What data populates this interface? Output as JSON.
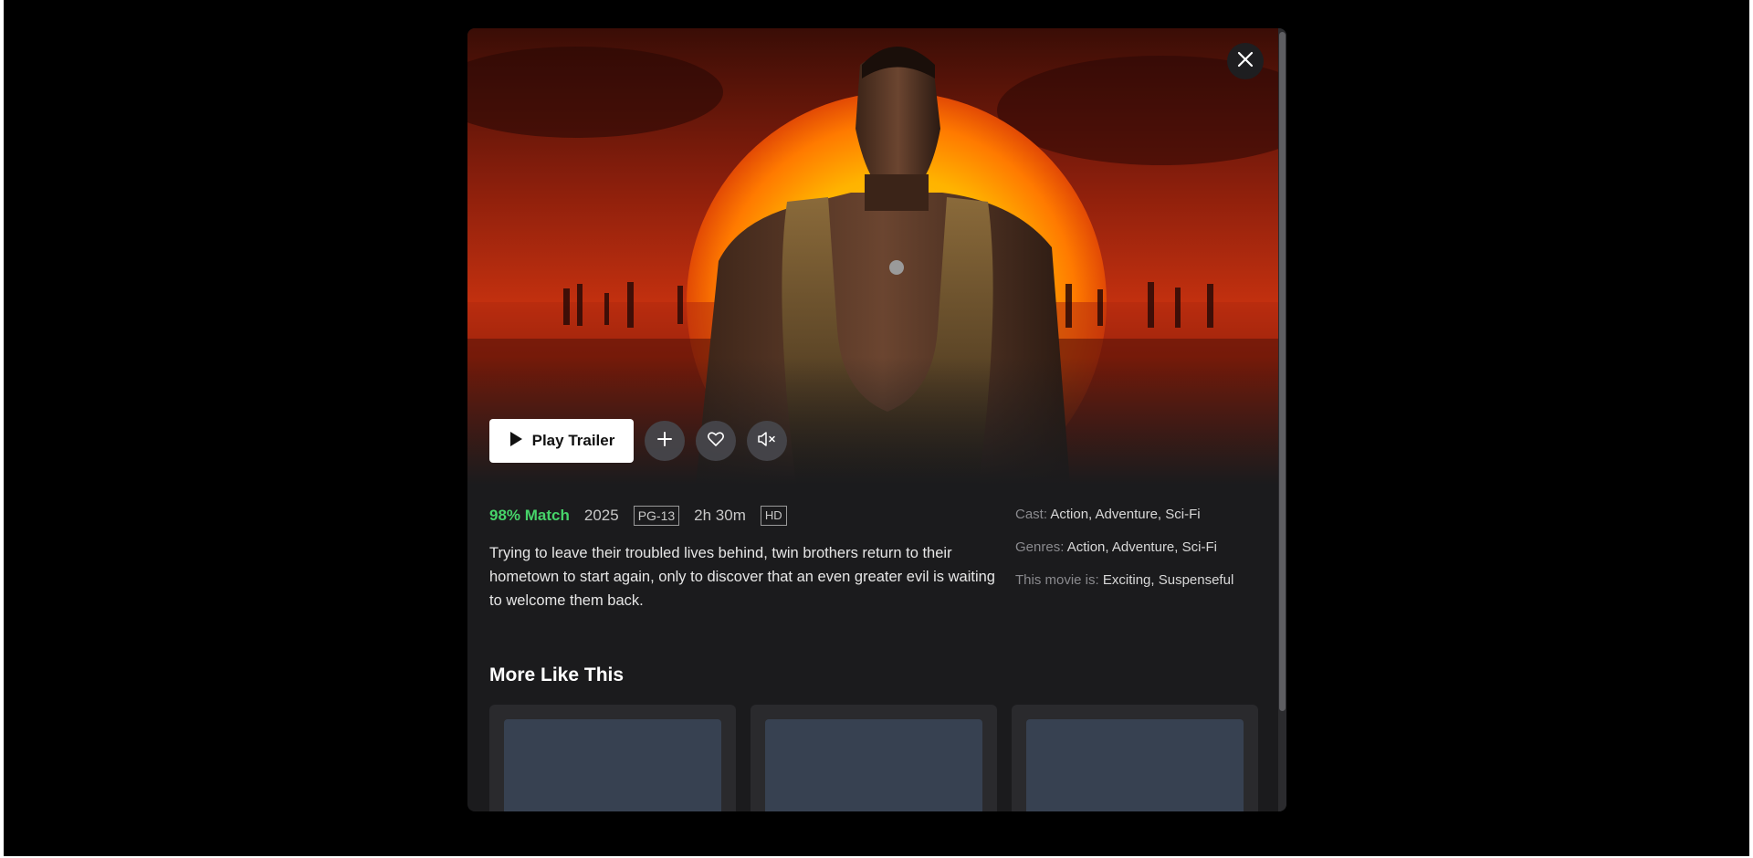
{
  "modal": {
    "close_label": "Close"
  },
  "actions": {
    "play_label": "Play Trailer"
  },
  "meta": {
    "match": "98% Match",
    "year": "2025",
    "rating": "PG-13",
    "runtime": "2h 30m",
    "quality": "HD"
  },
  "synopsis": "Trying to leave their troubled lives behind, twin brothers return to their hometown to start again, only to discover that an even greater evil is waiting to welcome them back.",
  "side_info": {
    "cast_label": "Cast:",
    "cast_value": "Action, Adventure, Sci-Fi",
    "genres_label": "Genres:",
    "genres_value": "Action, Adventure, Sci-Fi",
    "mood_label": "This movie is:",
    "mood_value": "Exciting, Suspenseful"
  },
  "more_like_this": {
    "title": "More Like This",
    "cards": [
      {},
      {},
      {}
    ]
  },
  "colors": {
    "match_green": "#46d369",
    "modal_bg": "#1b1b1d",
    "card_placeholder": "#374151"
  },
  "icons": {
    "close": "close-icon",
    "play": "play-icon",
    "add": "plus-icon",
    "like": "heart-icon",
    "mute": "volume-mute-icon"
  }
}
